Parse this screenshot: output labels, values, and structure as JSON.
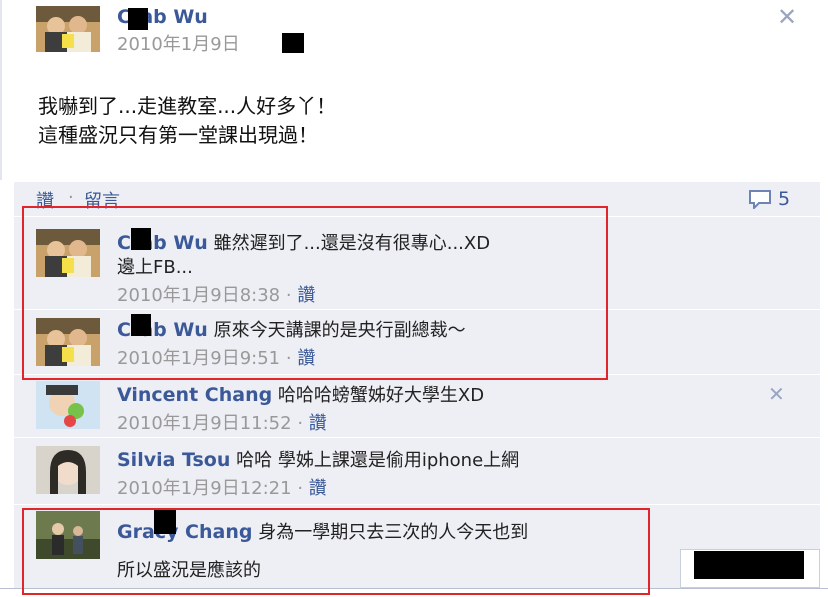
{
  "post": {
    "author": "Crab Wu",
    "date": "2010年1月9日",
    "body_line1": "我嚇到了...走進教室...人好多丫！",
    "body_line2": "這種盛況只有第一堂課出現過！"
  },
  "actions": {
    "like": "讚",
    "separator": "·",
    "comment": "留言",
    "comment_count": "5"
  },
  "comments": [
    {
      "name": "Crab Wu",
      "text_line1": " 雖然遲到了...還是沒有很專心...XD",
      "text_line2": "邊上FB...",
      "time": "2010年1月9日8:38",
      "like": "讚"
    },
    {
      "name": "Crab Wu",
      "text_line1": " 原來今天講課的是央行副總裁～",
      "time": "2010年1月9日9:51",
      "like": "讚"
    },
    {
      "name": "Vincent Chang",
      "text_line1": " 哈哈哈螃蟹姊好大學生XD",
      "time": "2010年1月9日11:52",
      "like": "讚"
    },
    {
      "name": "Silvia Tsou",
      "text_line1": " 哈哈 學姊上課還是偷用iphone上網",
      "time": "2010年1月9日12:21",
      "like": "讚"
    },
    {
      "name": "Gracy Chang",
      "text_line1": " 身為一學期只去三次的人今天也到",
      "text_line2": "所以盛況是應該的"
    }
  ],
  "colors": {
    "link": "#3b5998",
    "muted": "#999999",
    "panel": "#edeff4",
    "highlight_box": "#e0262b"
  }
}
